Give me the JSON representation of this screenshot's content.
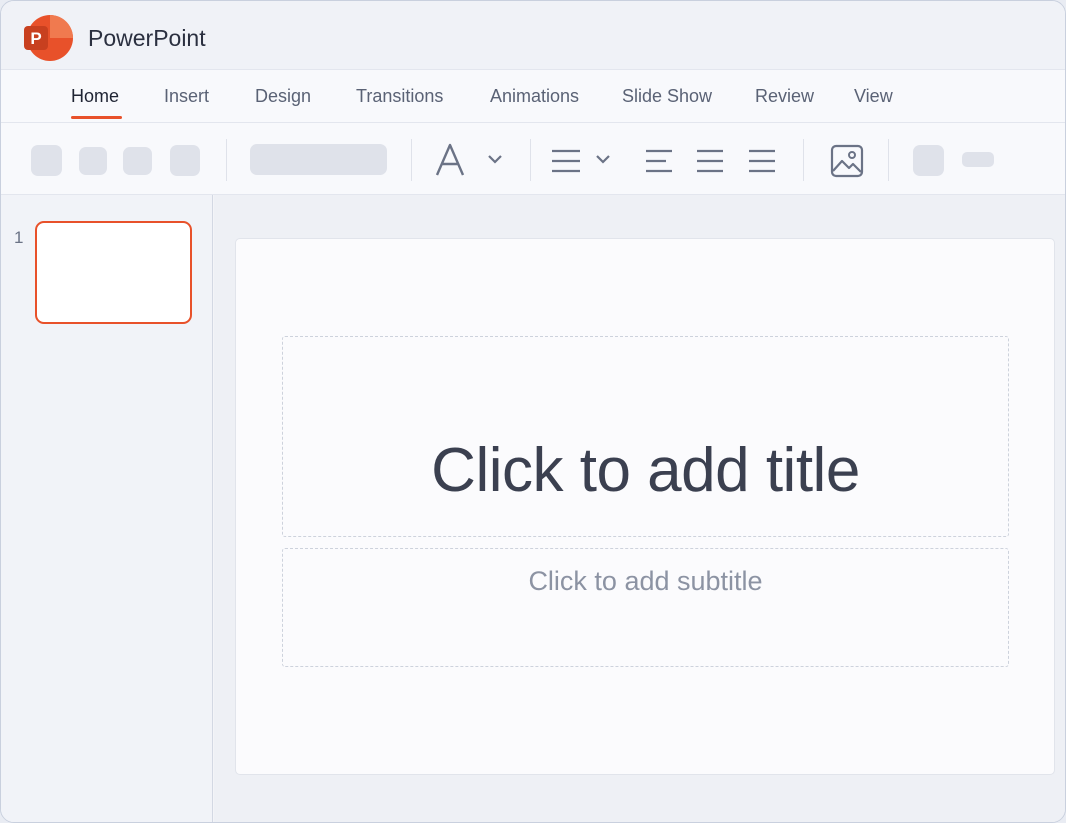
{
  "app": {
    "title": "PowerPoint",
    "logo_letter": "P",
    "accent_color": "#e8512a"
  },
  "ribbon": {
    "tabs": [
      {
        "label": "Home",
        "active": true
      },
      {
        "label": "Insert",
        "active": false
      },
      {
        "label": "Design",
        "active": false
      },
      {
        "label": "Transitions",
        "active": false
      },
      {
        "label": "Animations",
        "active": false
      },
      {
        "label": "Slide Show",
        "active": false
      },
      {
        "label": "Review",
        "active": false
      },
      {
        "label": "View",
        "active": false
      }
    ]
  },
  "toolbar": {
    "icons": [
      "font-icon",
      "chevron-down-icon",
      "line-spacing-icon",
      "align-left-icon",
      "align-center-icon",
      "align-justify-icon",
      "picture-icon"
    ]
  },
  "sidebar": {
    "slides": [
      {
        "number": "1"
      }
    ]
  },
  "slide": {
    "title_placeholder": "Click to add title",
    "subtitle_placeholder": "Click to add subtitle"
  }
}
